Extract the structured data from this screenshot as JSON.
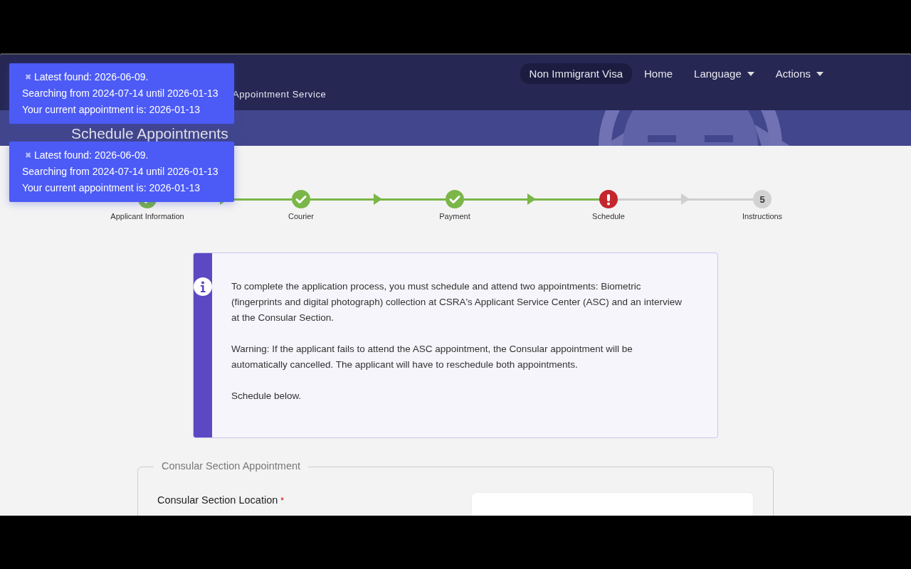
{
  "navbar": {
    "brand": "Appointment Service",
    "items": [
      {
        "label": "Non Immigrant Visa",
        "selected": true,
        "dropdown": false
      },
      {
        "label": "Home",
        "selected": false,
        "dropdown": false
      },
      {
        "label": "Language",
        "selected": false,
        "dropdown": true
      },
      {
        "label": "Actions",
        "selected": false,
        "dropdown": true
      }
    ]
  },
  "banner": {
    "title": "Schedule Appointments"
  },
  "toasts": [
    {
      "close": "✖",
      "lines": [
        "Latest found: 2026-06-09.",
        "Searching from 2024-07-14 until 2026-01-13",
        "Your current appointment is: 2026-01-13"
      ]
    },
    {
      "close": "✖",
      "lines": [
        "Latest found: 2026-06-09.",
        "Searching from 2024-07-14 until 2026-01-13",
        "Your current appointment is: 2026-01-13"
      ]
    }
  ],
  "steps": [
    {
      "label": "Applicant Information",
      "kind": "done"
    },
    {
      "label": "Courier",
      "kind": "done"
    },
    {
      "label": "Payment",
      "kind": "done"
    },
    {
      "label": "Schedule",
      "kind": "error"
    },
    {
      "label": "Instructions",
      "kind": "pending",
      "number": "5"
    }
  ],
  "info": {
    "paragraphs": [
      "To complete the application process, you must schedule and attend two appointments: Biometric (fingerprints and digital photograph) collection at CSRA's Applicant Service Center (ASC) and an interview at the Consular Section.",
      "Warning: If the applicant fails to attend the ASC appointment, the Consular appointment will be automatically cancelled. The applicant will have to reschedule both appointments.",
      "Schedule below."
    ]
  },
  "section": {
    "legend": "Consular Section Appointment",
    "fields": [
      {
        "label": "Consular Section Location",
        "required_mark": "*"
      }
    ]
  }
}
